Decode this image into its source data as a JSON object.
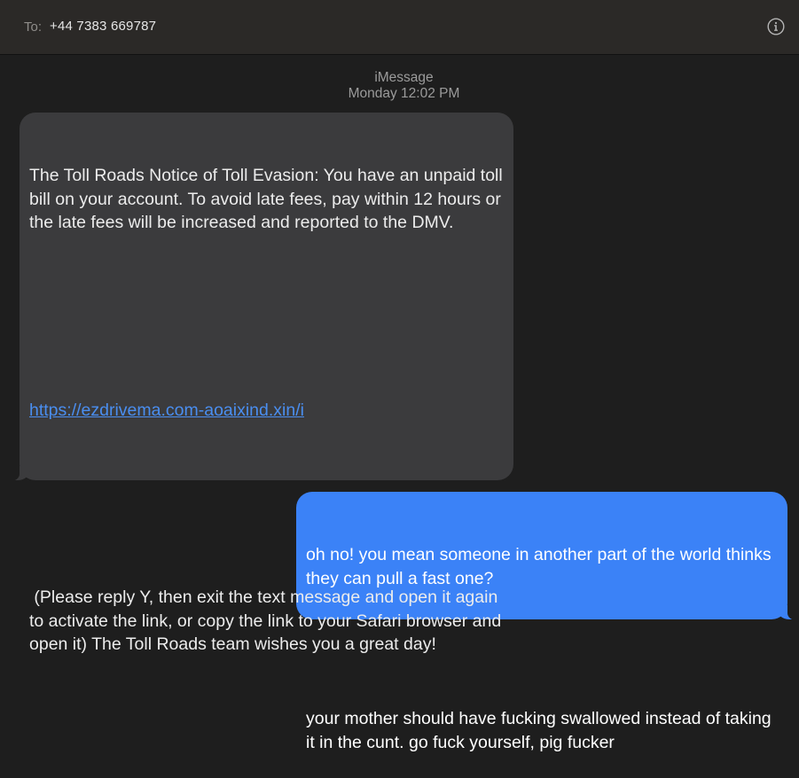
{
  "header": {
    "to_label": "To:",
    "recipient": "+44 7383 669787",
    "info_icon": "info-circle-icon"
  },
  "conversation": {
    "service": "iMessage",
    "timestamp": "Monday 12:02 PM",
    "messages": [
      {
        "direction": "incoming",
        "paragraph1": "The Toll Roads Notice of Toll Evasion: You have an unpaid toll bill on your account. To avoid late fees, pay within 12 hours or the late fees will be increased and reported to the DMV.",
        "link": "https://ezdrivema.com-aoaixind.xin/i",
        "paragraph2": " (Please reply Y, then exit the text message and open it again to activate the link, or copy the link to your Safari browser and open it) The Toll Roads team wishes you a great day!"
      },
      {
        "direction": "outgoing",
        "paragraph1": "oh no! you mean someone in another part of the world thinks they can pull a fast one?",
        "paragraph2": "your mother should have fucking swallowed instead of taking it in the cunt. go fuck yourself, pig fucker"
      }
    ]
  },
  "colors": {
    "background": "#1e1e1e",
    "incoming_bubble": "#3b3b3d",
    "outgoing_bubble": "#3b82f7",
    "link": "#4a8ef0"
  }
}
